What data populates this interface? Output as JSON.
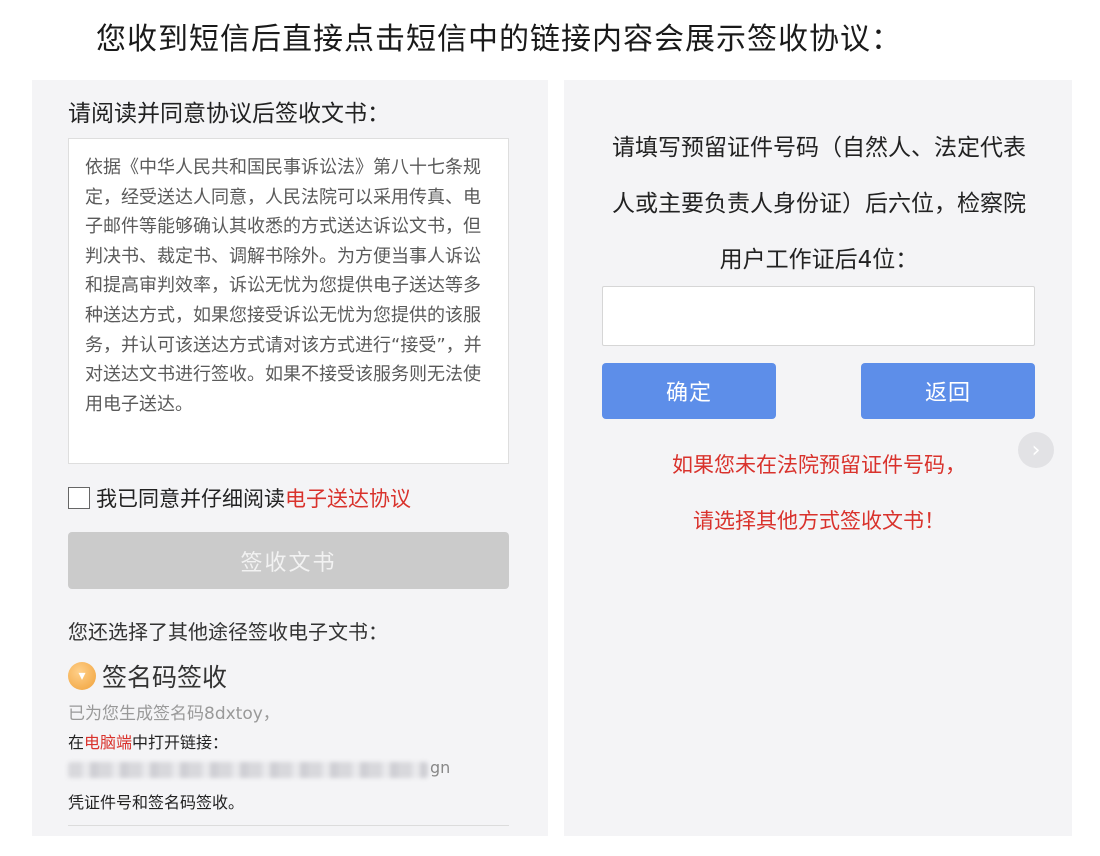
{
  "caption": "您收到短信后直接点击短信中的链接内容会展示签收协议：",
  "left_panel": {
    "heading": "请阅读并同意协议后签收文书：",
    "agreement_text": "依据《中华人民共和国民事诉讼法》第八十七条规定，经受送达人同意，人民法院可以采用传真、电子邮件等能够确认其收悉的方式送达诉讼文书，但判决书、裁定书、调解书除外。为方便当事人诉讼和提高审判效率，诉讼无忧为您提供电子送达等多种送达方式，如果您接受诉讼无忧为您提供的该服务，并认可该送达方式请对该方式进行“接受”，并对送达文书进行签收。如果不接受该服务则无法使用电子送达。",
    "agree_label": "我已同意并仔细阅读",
    "agree_link": "电子送达协议",
    "sign_button": "签收文书",
    "other_methods_title": "您还选择了其他途径签收电子文书：",
    "method": {
      "icon": "coin-icon",
      "title": "签名码签收",
      "code_line": "已为您生成签名码8dxtoy，",
      "open_prefix": "在",
      "open_highlight": "电脑端",
      "open_suffix": "中打开链接：",
      "link_tail": "gn",
      "verify_line": "凭证件号和签名码签收。"
    }
  },
  "right_panel": {
    "instruction": "请填写预留证件号码（自然人、法定代表人或主要负责人身份证）后六位，检察院用户工作证后4位：",
    "input_value": "",
    "input_placeholder": "",
    "confirm_button": "确定",
    "back_button": "返回",
    "warning_line1": "如果您未在法院预留证件号码，",
    "warning_line2": "请选择其他方式签收文书！",
    "next_icon": "chevron-right-icon"
  },
  "colors": {
    "accent_blue": "#5d8ee9",
    "warning_red": "#d9322c",
    "disabled_gray": "#cbcbcb"
  }
}
